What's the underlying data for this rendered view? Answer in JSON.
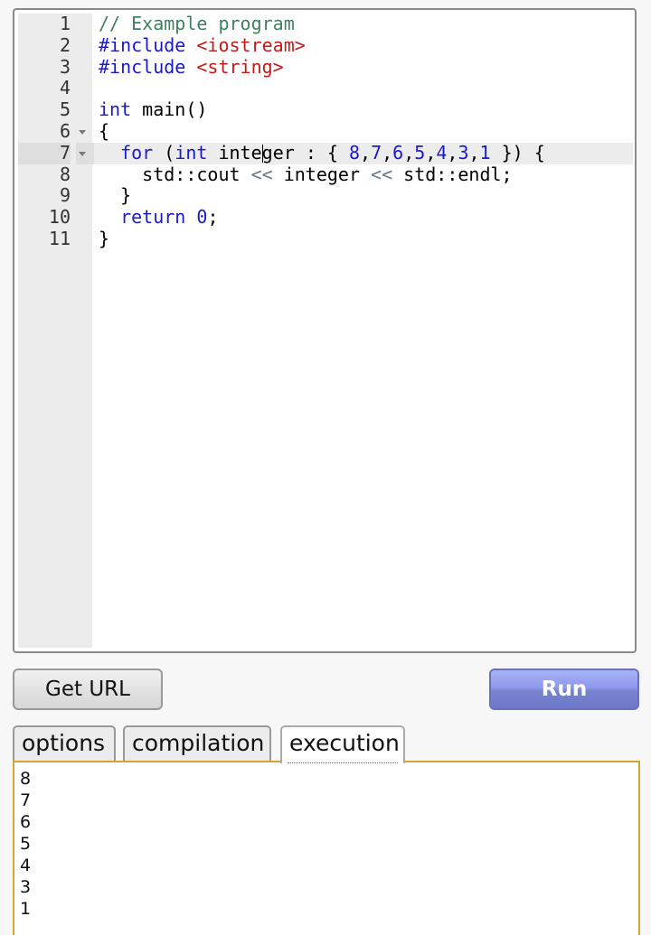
{
  "editor": {
    "lines": [
      {
        "n": "1",
        "fold": false,
        "tokens": [
          {
            "t": "// Example program",
            "c": "t-comment"
          }
        ]
      },
      {
        "n": "2",
        "fold": false,
        "tokens": [
          {
            "t": "#include ",
            "c": "t-kw"
          },
          {
            "t": "<iostream>",
            "c": "t-str"
          }
        ]
      },
      {
        "n": "3",
        "fold": false,
        "tokens": [
          {
            "t": "#include ",
            "c": "t-kw"
          },
          {
            "t": "<string>",
            "c": "t-str"
          }
        ]
      },
      {
        "n": "4",
        "fold": false,
        "tokens": []
      },
      {
        "n": "5",
        "fold": false,
        "tokens": [
          {
            "t": "int",
            "c": "t-kw"
          },
          {
            "t": " main()",
            "c": ""
          }
        ]
      },
      {
        "n": "6",
        "fold": true,
        "tokens": [
          {
            "t": "{",
            "c": ""
          }
        ]
      },
      {
        "n": "7",
        "fold": true,
        "active": true,
        "tokens": [
          {
            "t": "  ",
            "c": ""
          },
          {
            "t": "for",
            "c": "t-kw"
          },
          {
            "t": " (",
            "c": ""
          },
          {
            "t": "int",
            "c": "t-kw"
          },
          {
            "t": " inte",
            "c": ""
          },
          {
            "caret": true
          },
          {
            "t": "ger : { ",
            "c": ""
          },
          {
            "t": "8",
            "c": "t-num"
          },
          {
            "t": ",",
            "c": ""
          },
          {
            "t": "7",
            "c": "t-num"
          },
          {
            "t": ",",
            "c": ""
          },
          {
            "t": "6",
            "c": "t-num"
          },
          {
            "t": ",",
            "c": ""
          },
          {
            "t": "5",
            "c": "t-num"
          },
          {
            "t": ",",
            "c": ""
          },
          {
            "t": "4",
            "c": "t-num"
          },
          {
            "t": ",",
            "c": ""
          },
          {
            "t": "3",
            "c": "t-num"
          },
          {
            "t": ",",
            "c": ""
          },
          {
            "t": "1",
            "c": "t-num"
          },
          {
            "t": " }) {",
            "c": ""
          }
        ]
      },
      {
        "n": "8",
        "fold": false,
        "tokens": [
          {
            "t": "    std::cout ",
            "c": ""
          },
          {
            "t": "<<",
            "c": "t-op"
          },
          {
            "t": " integer ",
            "c": ""
          },
          {
            "t": "<<",
            "c": "t-op"
          },
          {
            "t": " std::endl;",
            "c": ""
          }
        ]
      },
      {
        "n": "9",
        "fold": false,
        "tokens": [
          {
            "t": "  }",
            "c": ""
          }
        ]
      },
      {
        "n": "10",
        "fold": false,
        "tokens": [
          {
            "t": "  ",
            "c": ""
          },
          {
            "t": "return",
            "c": "t-kw"
          },
          {
            "t": " ",
            "c": ""
          },
          {
            "t": "0",
            "c": "t-num"
          },
          {
            "t": ";",
            "c": ""
          }
        ]
      },
      {
        "n": "11",
        "fold": false,
        "tokens": [
          {
            "t": "}",
            "c": ""
          }
        ]
      }
    ]
  },
  "buttons": {
    "get_url": "Get URL",
    "run": "Run"
  },
  "tabs": {
    "options": "options",
    "compilation": "compilation",
    "execution": "execution",
    "active": "execution"
  },
  "output": {
    "lines": [
      "8",
      "7",
      "6",
      "5",
      "4",
      "3",
      "1"
    ]
  },
  "colors": {
    "run_button": "#8d99ea",
    "output_border": "#d4a235",
    "keyword": "#1a1acc",
    "string": "#c41a16",
    "comment": "#3f7f5f"
  }
}
